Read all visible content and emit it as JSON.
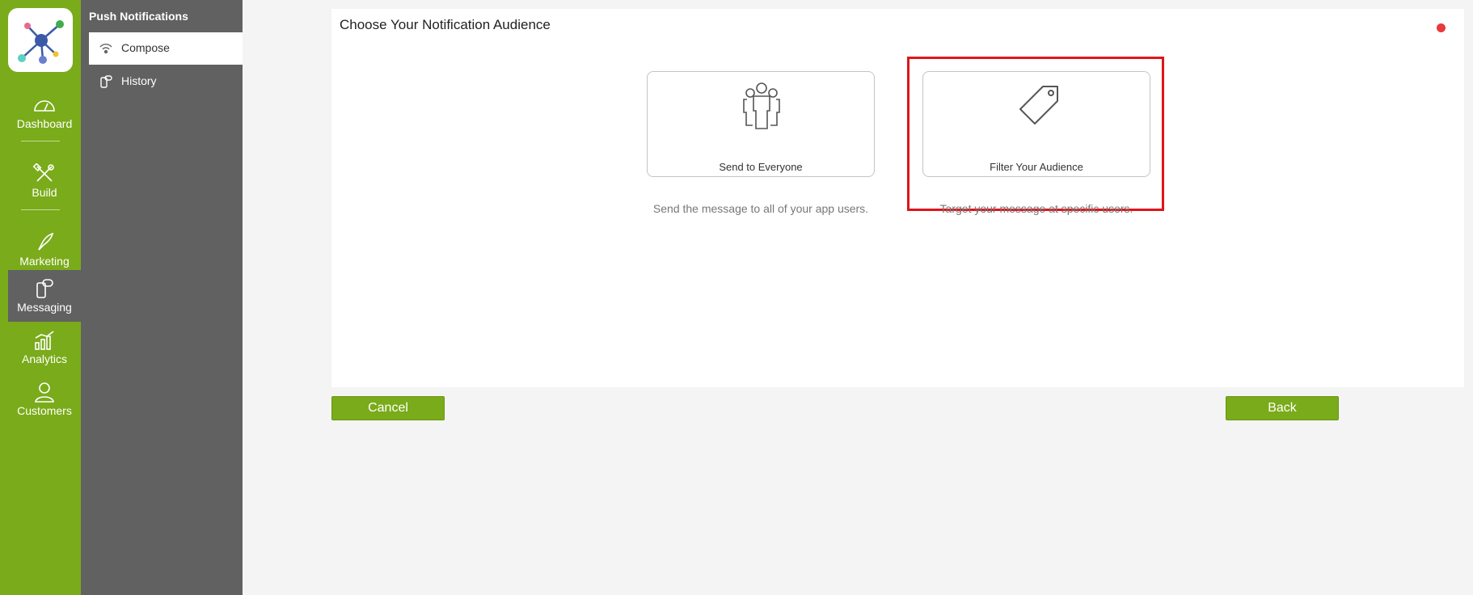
{
  "rail": {
    "logo_icon": "network-logo-icon",
    "items": [
      {
        "label": "Dashboard",
        "icon": "gauge-icon"
      },
      {
        "label": "Build",
        "icon": "tools-icon"
      },
      {
        "label": "Marketing",
        "icon": "rocket-icon"
      },
      {
        "label": "Messaging",
        "icon": "phone-chat-icon",
        "active": true
      },
      {
        "label": "Analytics",
        "icon": "bar-chart-icon"
      },
      {
        "label": "Customers",
        "icon": "person-icon"
      }
    ]
  },
  "subnav": {
    "title": "Push Notifications",
    "items": [
      {
        "label": "Compose",
        "icon": "broadcast-icon",
        "active": true
      },
      {
        "label": "History",
        "icon": "phone-history-icon"
      }
    ]
  },
  "panel": {
    "title": "Choose Your Notification Audience",
    "status_color": "#e8393b",
    "options": [
      {
        "label": "Send to Everyone",
        "description": "Send the message to all of your app users.",
        "icon": "group-people-icon"
      },
      {
        "label": "Filter Your Audience",
        "description": "Target your message at specific users.",
        "icon": "tag-icon",
        "highlighted": true
      }
    ]
  },
  "buttons": {
    "cancel": "Cancel",
    "back": "Back"
  },
  "colors": {
    "accent": "#7aab1a",
    "sidebar": "#616161",
    "highlight": "#e0151a"
  }
}
